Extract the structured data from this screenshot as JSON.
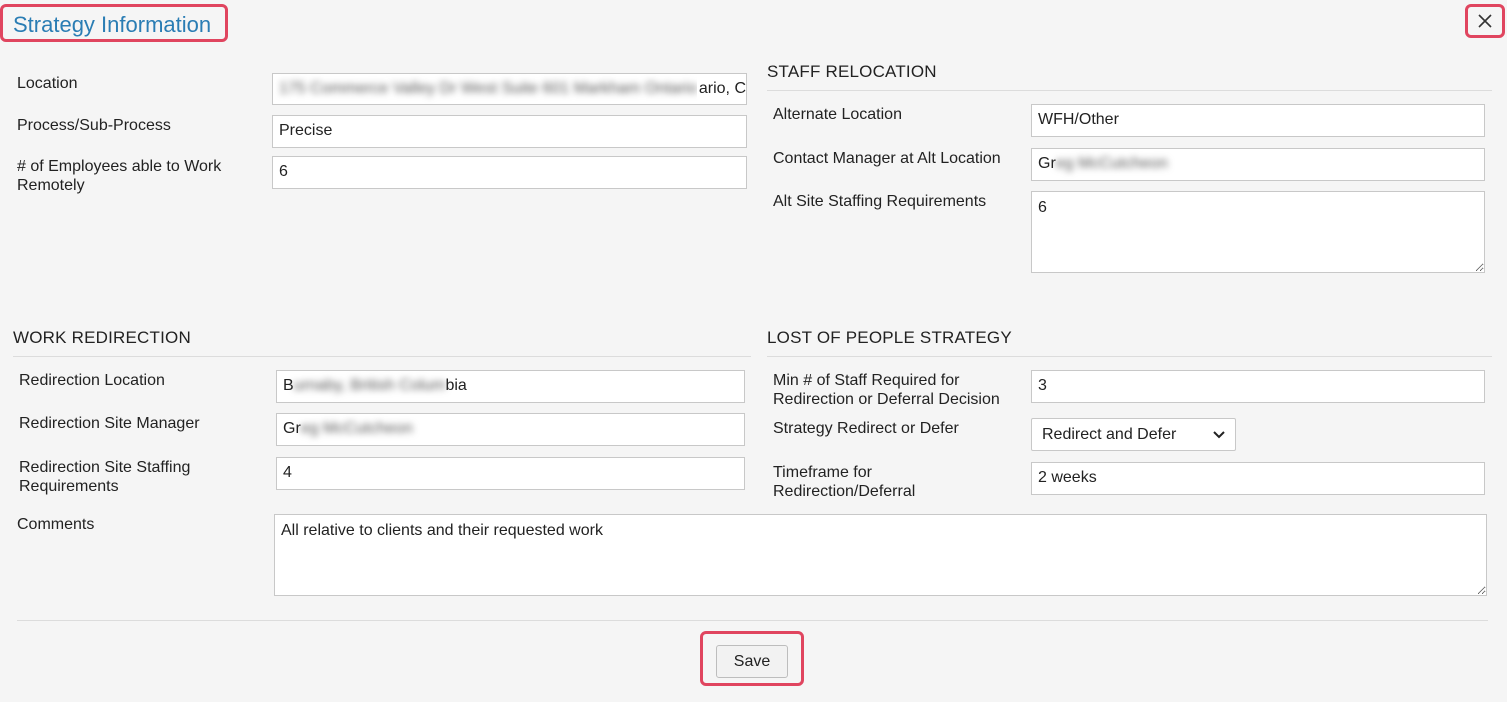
{
  "dialog": {
    "title": "Strategy Information",
    "close_label": "X",
    "save_label": "Save"
  },
  "general": {
    "location_label": "Location",
    "location_value_hidden": "175 Commerce Valley Dr West Suite 601 Markham Ontario",
    "location_value_visible": "ario, C",
    "process_label": "Process/Sub-Process",
    "process_value": "Precise",
    "remote_label": "# of Employees able to Work Remotely",
    "remote_value": "6"
  },
  "staff_relocation": {
    "heading": "STAFF RELOCATION",
    "alt_location_label": "Alternate Location",
    "alt_location_value": "WFH/Other",
    "contact_label": "Contact Manager at Alt Location",
    "contact_value_visible": "Gr",
    "contact_value_hidden": "eg McCutcheon",
    "staffing_label": "Alt Site Staffing Requirements",
    "staffing_value": "6"
  },
  "work_redirection": {
    "heading": "WORK REDIRECTION",
    "location_label": "Redirection Location",
    "location_value_start": "B",
    "location_value_hidden": "urnaby, British Colum",
    "location_value_end": "bia",
    "manager_label": "Redirection Site Manager",
    "manager_value_visible": "Gr",
    "manager_value_hidden": "eg McCutcheon",
    "staffing_label": "Redirection Site Staffing Requirements",
    "staffing_value": "4",
    "comments_label": "Comments",
    "comments_value": "All relative to clients and their requested work"
  },
  "lost_people": {
    "heading": "LOST OF PEOPLE STRATEGY",
    "min_staff_label": "Min # of Staff Required for Redirection or Deferral Decision",
    "min_staff_value": "3",
    "strategy_label": "Strategy Redirect or Defer",
    "strategy_value": "Redirect and Defer",
    "timeframe_label": "Timeframe for Redirection/Deferral",
    "timeframe_value": "2 weeks"
  },
  "icons": {
    "close": "close-icon",
    "dropdown": "chevron-down-icon",
    "resize": "resize-grip-icon"
  },
  "colors": {
    "highlight": "#e0455f",
    "title": "#2a7db4"
  }
}
